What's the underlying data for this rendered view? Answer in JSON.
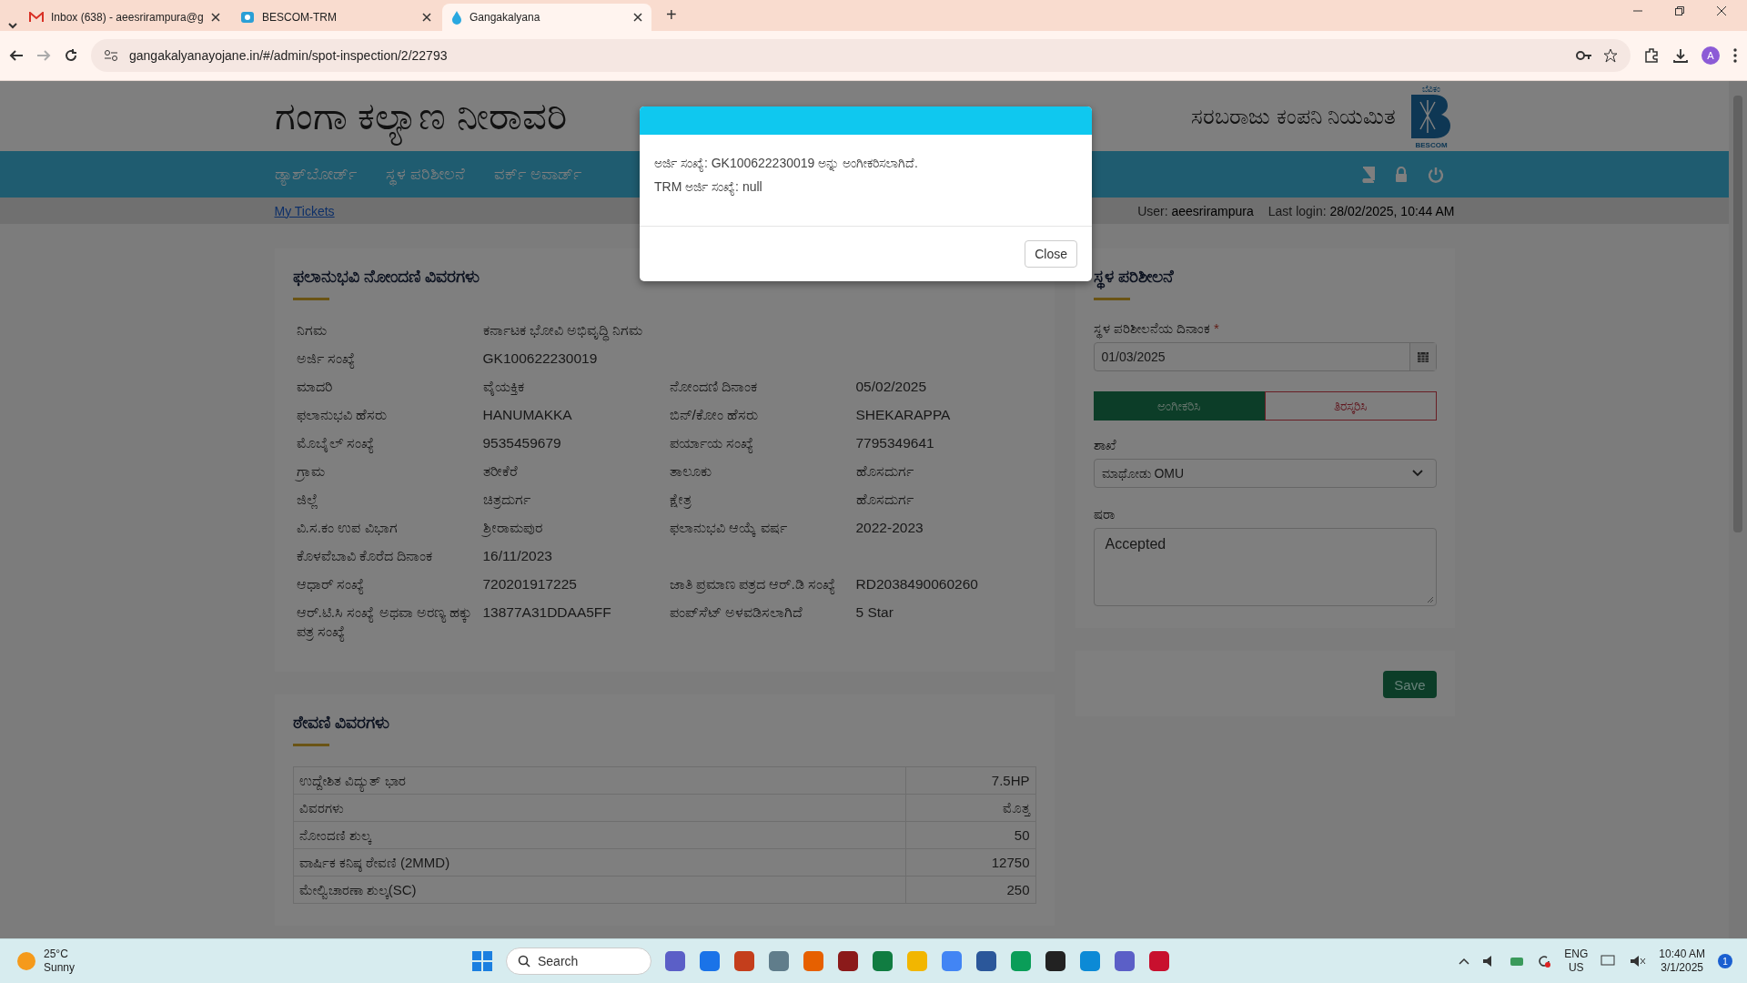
{
  "browser": {
    "tabs": [
      {
        "title": "Inbox (638) - aeesrirampura@g",
        "kind": "mail",
        "selected": false
      },
      {
        "title": "BESCOM-TRM",
        "kind": "web",
        "selected": false
      },
      {
        "title": "Gangakalyana",
        "kind": "drop",
        "selected": true
      }
    ],
    "url": "gangakalyanayojane.in/#/admin/spot-inspection/2/22793",
    "profile_initial": "A",
    "new_tab_label": "+"
  },
  "header": {
    "title": "ಗಂಗಾ ಕಲ್ಯಾಣ ನೀರಾವರಿ",
    "company": "ಸರಬರಾಜು ಕಂಪನಿ ನಿಯಮಿತ",
    "logo_top": "ಬೆವಿಕಂ",
    "logo_bottom": "BESCOM"
  },
  "nav": {
    "items": [
      "ಡ್ಯಾಶ್‌ಬೋರ್ಡ್",
      "ಸ್ಥಳ ಪರಿಶೀಲನೆ",
      "ವರ್ಕ್ ಅವಾರ್ಡ್"
    ]
  },
  "subbar": {
    "link": "My Tickets",
    "user": "User: **aeesrirampura**",
    "last_login": "Last login: **28/02/2025, 10:44 AM**"
  },
  "beneficiary": {
    "title": "ಫಲಾನುಭವಿ ನೋಂದಣಿ ವಿವರಗಳು",
    "rows": [
      {
        "cells": [
          {
            "label": "ನಿಗಮ",
            "value": "ಕರ್ನಾಟಕ ಭೋವಿ ಅಭಿವೃದ್ಧಿ ನಿಗಮ"
          }
        ]
      },
      {
        "cells": [
          {
            "label": "ಅರ್ಜಿ ಸಂಖ್ಯೆ",
            "value": "GK100622230019"
          }
        ]
      },
      {
        "cells": [
          {
            "label": "ಮಾದರಿ",
            "value": "ವೈಯಕ್ತಿಕ"
          },
          {
            "label": "ನೋಂದಣಿ ದಿನಾಂಕ",
            "value": "05/02/2025"
          }
        ]
      },
      {
        "cells": [
          {
            "label": "ಫಲಾನುಭವಿ ಹೆಸರು",
            "value": "HANUMAKKA"
          },
          {
            "label": "ಬಿನ್/ಕೋಂ ಹೆಸರು",
            "value": "SHEKARAPPA"
          }
        ]
      },
      {
        "cells": [
          {
            "label": "ಮೊಬೈಲ್ ಸಂಖ್ಯೆ",
            "value": "9535459679"
          },
          {
            "label": "ಪರ್ಯಾಯ ಸಂಖ್ಯೆ",
            "value": "7795349641"
          }
        ]
      },
      {
        "cells": [
          {
            "label": "ಗ್ರಾಮ",
            "value": "ತರೀಕೆರೆ"
          },
          {
            "label": "ತಾಲೂಕು",
            "value": "ಹೊಸದುರ್ಗ"
          }
        ]
      },
      {
        "cells": [
          {
            "label": "ಜಿಲ್ಲೆ",
            "value": "ಚಿತ್ರದುರ್ಗ"
          },
          {
            "label": "ಕ್ಷೇತ್ರ",
            "value": "ಹೊಸದುರ್ಗ"
          }
        ]
      },
      {
        "cells": [
          {
            "label": "ವಿ.ಸ.ಕಂ ಉಪ ವಿಭಾಗ",
            "value": "ಶ್ರೀರಾಮಪುರ"
          },
          {
            "label": "ಫಲಾನುಭವಿ ಆಯ್ಕೆ ವರ್ಷ",
            "value": "2022-2023"
          }
        ]
      },
      {
        "cells": [
          {
            "label": "ಕೊಳವೆಬಾವಿ ಕೊರೆದ ದಿನಾಂಕ",
            "value": "16/11/2023"
          }
        ]
      },
      {
        "cells": [
          {
            "label": "ಆಧಾರ್ ಸಂಖ್ಯೆ",
            "value": "720201917225"
          },
          {
            "label": "ಜಾತಿ ಪ್ರಮಾಣ ಪತ್ರದ ಆರ್.ಡಿ ಸಂಖ್ಯೆ",
            "value": "RD2038490060260"
          }
        ]
      },
      {
        "cells": [
          {
            "label": "ಆರ್.ಟಿ.ಸಿ ಸಂಖ್ಯೆ ಅಥವಾ ಅರಣ್ಯ ಹಕ್ಕು ಪತ್ರ ಸಂಖ್ಯೆ",
            "value": "13877A31DDAA5FF"
          },
          {
            "label": "ಪಂಪ್‌ಸೆಟ್ ಅಳವಡಿಸಲಾಗಿದೆ",
            "value": "5 Star"
          }
        ]
      }
    ]
  },
  "inspection": {
    "title": "ಸ್ಥಳ ಪರಿಶೀಲನೆ",
    "date_label": "ಸ್ಥಳ ಪರಿಶೀಲನೆಯ ದಿನಾಂಕ",
    "required_mark": "*",
    "date": "01/03/2025",
    "decision": [
      {
        "label": "ಅಂಗೀಕರಿಸಿ",
        "selected": true
      },
      {
        "label": "ತಿರಸ್ಕರಿಸಿ",
        "selected": false
      }
    ],
    "branch_label": "ಶಾಖೆ",
    "branch": "ಮಾಥೋಡು OMU",
    "remarks_label": "ಷರಾ",
    "remarks": "Accepted",
    "save": "Save"
  },
  "fees": {
    "title": "ಠೇವಣಿ ವಿವರಗಳು",
    "rows": [
      {
        "label": "ಉದ್ದೇಶಿತ ವಿದ್ಯುತ್ ಭಾರ",
        "value": "7.5HP"
      },
      {
        "label": "ವಿವರಗಳು",
        "value": "ಮೊತ್ತ"
      },
      {
        "label": "ನೋಂದಣಿ ಶುಲ್ಕ",
        "value": "50"
      },
      {
        "label": "ವಾರ್ಷಿಕ ಕನಿಷ್ಠ ಠೇವಣಿ (2MMD)",
        "value": "12750"
      },
      {
        "label": "ಮೇಲ್ವಿಚಾರಣಾ ಶುಲ್ಕ(SC)",
        "value": "250"
      }
    ]
  },
  "modal": {
    "lines": [
      "ಅರ್ಜಿ ಸಂಖ್ಯೆ: GK100622230019 ಅನ್ನು ಅಂಗೀಕರಿಸಲಾಗಿದೆ.",
      "TRM ಅರ್ಜಿ ಸಂಖ್ಯೆ: null"
    ],
    "close": "Close"
  },
  "taskbar": {
    "temperature": "25°C",
    "weather": "Sunny",
    "search_placeholder": "Search",
    "language": "ENG",
    "region": "US",
    "time": "10:40 AM",
    "date": "3/1/2025",
    "notifications": "1"
  }
}
